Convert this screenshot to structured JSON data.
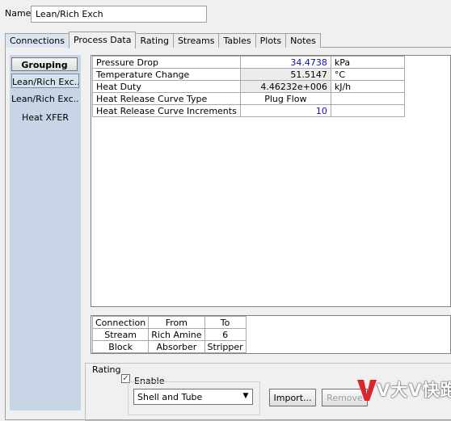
{
  "name": {
    "label": "Name",
    "value": "Lean/Rich Exch"
  },
  "tabs": [
    "Connections",
    "Process Data",
    "Rating",
    "Streams",
    "Tables",
    "Plots",
    "Notes"
  ],
  "sidebar": {
    "grouping": "Grouping",
    "items": [
      "Lean/Rich Exc...",
      "Lean/Rich Exc...",
      "Heat XFER"
    ]
  },
  "process_data": {
    "rows": [
      {
        "label": "Pressure Drop",
        "value": "34.4738",
        "unit": "kPa"
      },
      {
        "label": "Temperature Change",
        "value": "51.5147",
        "unit": "°C"
      },
      {
        "label": "Heat Duty",
        "value": "4.46232e+006",
        "unit": "kJ/h"
      },
      {
        "label": "Heat Release Curve Type",
        "value": "Plug Flow",
        "unit": ""
      },
      {
        "label": "Heat Release Curve Increments",
        "value": "10",
        "unit": ""
      }
    ]
  },
  "connections": {
    "headers": [
      "Connection",
      "From",
      "To"
    ],
    "rows": [
      [
        "Stream",
        "Rich Amine",
        "6"
      ],
      [
        "Block",
        "Absorber",
        "Stripper"
      ]
    ]
  },
  "rating": {
    "group_label": "Rating",
    "enable_label": "Enable",
    "enable_checked": "✓",
    "type_value": "Shell and Tube",
    "import_label": "Import...",
    "remove_label": "Remove"
  },
  "watermark": {
    "text": "V大V快跑"
  },
  "colors": {
    "sidebar": "#c7d5e6",
    "value_blue": "#1010c0"
  }
}
